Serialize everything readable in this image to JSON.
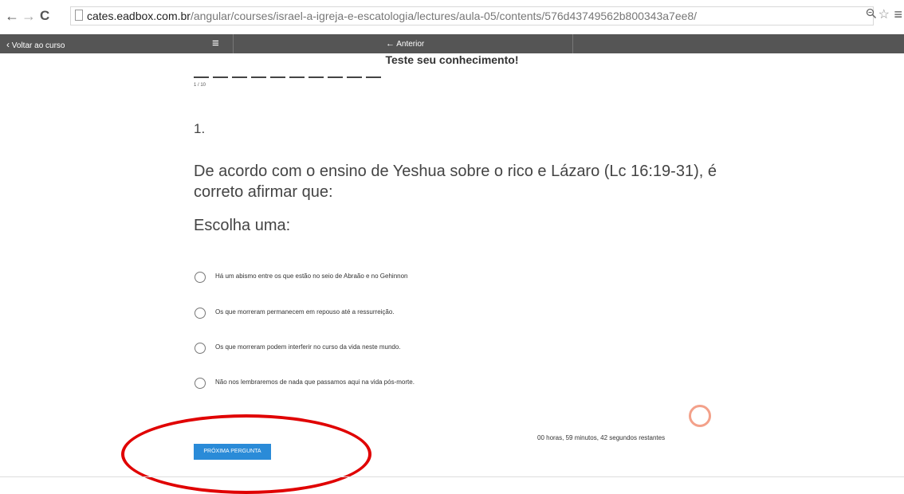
{
  "browser": {
    "back_icon": "←",
    "forward_icon": "→",
    "reload_icon": "C",
    "url_host": "cates.eadbox.com.br",
    "url_path": "/angular/courses/israel-a-igreja-e-escatologia/lectures/aula-05/contents/576d43749562b800343a7ee8/",
    "zoom_icon": "magnifier-icon",
    "star_icon": "☆",
    "menu_icon": "≡"
  },
  "toolbar": {
    "back_label": "Voltar ao curso",
    "back_icon": "‹",
    "menu_icon": "≡",
    "prev_label": "Anterior",
    "prev_icon": "←"
  },
  "quiz": {
    "title": "Teste seu conhecimento!",
    "progress_label": "1 / 10",
    "progress": {
      "current": 1,
      "total": 10
    },
    "question_number": "1.",
    "question_text": "De acordo com o ensino de Yeshua sobre o rico e Lázaro (Lc 16:19-31), é correto afirmar que:",
    "choose_label": "Escolha uma:",
    "options": [
      {
        "label": "Há um abismo entre os que estão no seio de Abraão e no Gehinnon",
        "selected": false
      },
      {
        "label": "Os que morreram permanecem em repouso até a ressurreição.",
        "selected": false
      },
      {
        "label": "Os que morreram podem interferir no curso da vida neste mundo.",
        "selected": false
      },
      {
        "label": "Não nos lembraremos de nada que passamos aqui na vida pós-morte.",
        "selected": false
      }
    ],
    "timer_text": "00 horas, 59 minutos, 42 segundos restantes",
    "next_button": "PRÓXIMA PERGUNTA"
  },
  "colors": {
    "toolbar_bg": "#555555",
    "button_bg": "#2a8bd8",
    "annotation": "#e00000",
    "timer_ring": "#f3a18a"
  }
}
